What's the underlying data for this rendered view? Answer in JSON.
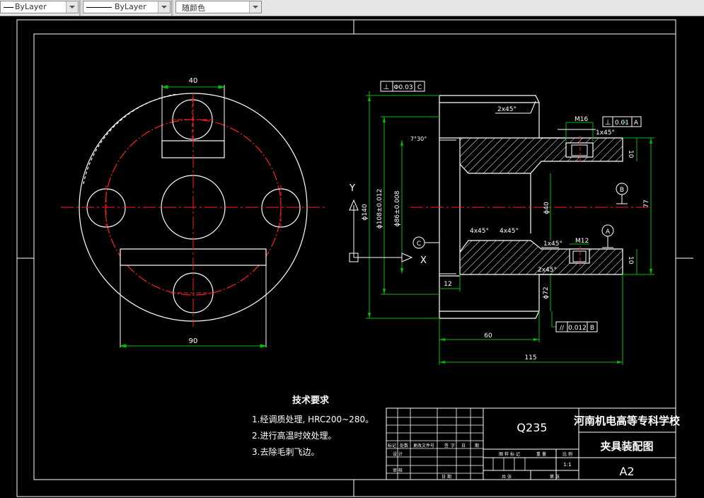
{
  "toolbar": {
    "linetype": "ByLayer",
    "lineweight": "ByLayer",
    "color": "随颜色"
  },
  "dims_left": {
    "top_width": "40",
    "bottom_width": "90"
  },
  "dims_right": {
    "tol_frame_top": {
      "symbol": "⊥",
      "value": "Φ0.03",
      "datum": "C"
    },
    "chamfer_top": "2x45°",
    "m16": "M16",
    "tol_frame_right": {
      "symbol": "⊥",
      "value": "0.01",
      "datum": "A"
    },
    "chamfer_small_top": "1x45°",
    "angle_label": "7°30°",
    "dim_10_top": "10",
    "phi140": "ϕ140",
    "phi108": "ϕ108±0.012",
    "phi86": "ϕ86±0.008",
    "phi40": "ϕ40",
    "datum_b": "B",
    "dim_77": "77",
    "chamfer_4x45_a": "4x45°",
    "chamfer_4x45_b": "4x45°",
    "datum_a": "A",
    "m12": "M12",
    "chamfer_small_bottom": "1x45°",
    "datum_c": "C",
    "dim_10_bottom": "10",
    "chamfer_bottom": "2x45°",
    "dim_12": "12",
    "phi72": "ϕ72",
    "tol_frame_bottom": {
      "symbol": "//",
      "value": "0.012",
      "datum": "B"
    },
    "dim_60": "60",
    "dim_115": "115"
  },
  "ucs": {
    "y": "Y",
    "x": "X"
  },
  "notes": {
    "title": "技术要求",
    "items": [
      "1.经调质处理, HRC200~280。",
      "2.进行高温时效处理。",
      "3.去除毛刺飞边。"
    ]
  },
  "title_block": {
    "material": "Q235",
    "school": "河南机电高等专科学校",
    "drawing_name": "夹具装配图",
    "sheet_size": "A2",
    "row_labels": [
      "标记",
      "处数",
      "更改文件号",
      "签",
      "字",
      "日",
      "期"
    ],
    "design_label": "设 计",
    "review_label": "审 核",
    "date_label": "日 期",
    "stage_label": "图 样 标 记",
    "weight_label": "重 量",
    "scale_label": "比 例",
    "scale_value": "1:1",
    "total_label": "共    张",
    "sheet_label": "第    张"
  }
}
